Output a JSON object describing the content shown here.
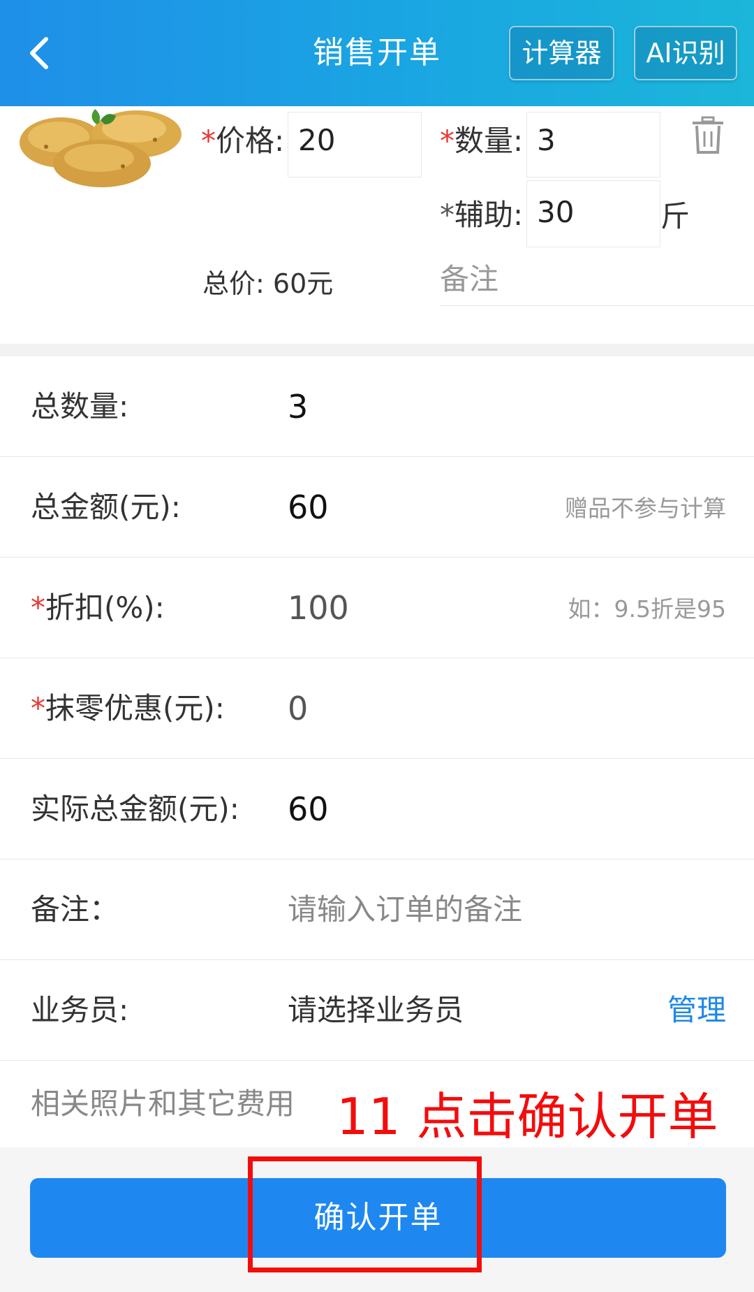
{
  "header": {
    "title": "销售开单",
    "calculator_label": "计算器",
    "ai_label": "AI识别",
    "background": "#1aa6e2"
  },
  "product": {
    "price_label": "价格:",
    "price_value": "20",
    "quantity_label": "数量:",
    "quantity_value": "3",
    "aux_label": "辅助:",
    "aux_value": "30",
    "aux_unit": "斤",
    "total_label": "总价: ",
    "total_value": "60元",
    "note_placeholder": "备注",
    "required_mark": "*"
  },
  "summary": {
    "total_qty_label": "总数量:",
    "total_qty_value": "3",
    "total_amount_label": "总金额(元):",
    "total_amount_value": "60",
    "total_amount_hint": "赠品不参与计算",
    "discount_label": "折扣(%):",
    "discount_value": "100",
    "discount_hint": "如：9.5折是95",
    "rounding_label": "抹零优惠(元):",
    "rounding_value": "0",
    "actual_total_label": "实际总金额(元):",
    "actual_total_value": "60",
    "note_label": "备注：",
    "note_placeholder": "请输入订单的备注",
    "salesman_label": "业务员:",
    "salesman_placeholder": "请选择业务员",
    "manage_link": "管理",
    "photos_label": "相关照片和其它费用"
  },
  "annotation": {
    "text": "11 点击确认开单",
    "color": "#f40c0c"
  },
  "footer": {
    "confirm_label": "确认开单",
    "button_color": "#1e88f0"
  }
}
